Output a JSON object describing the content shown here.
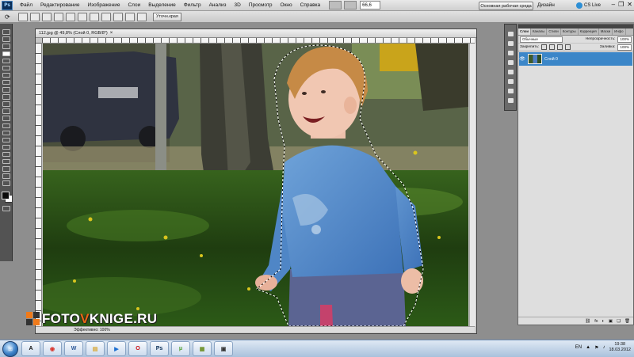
{
  "app": {
    "logo_text": "Ps"
  },
  "menu": {
    "items": [
      "Файл",
      "Редактирование",
      "Изображение",
      "Слои",
      "Выделение",
      "Фильтр",
      "Анализ",
      "3D",
      "Просмотр",
      "Окно",
      "Справка"
    ],
    "zoom": "66,6"
  },
  "workspace": {
    "button_label": "Основная рабочая среда",
    "design_label": "Дизайн",
    "cslive_label": "CS Live"
  },
  "window_controls": {
    "minimize": "–",
    "restore": "❐",
    "close": "✕"
  },
  "options_bar": {
    "tool_glyph": "⟳",
    "refine_edge": "Уточн.края"
  },
  "document": {
    "title": "112.jpg @ 49,8% (Слой 0, RGB/8*)",
    "close_glyph": "×",
    "status": "Эффективно: 100%"
  },
  "layers_panel": {
    "tabs": [
      "Слои",
      "Каналы",
      "Стили",
      "Контуры",
      "Коррекция",
      "Маски",
      "Инфо"
    ],
    "blend_mode": "Обычные",
    "opacity_label": "Непрозрачность:",
    "opacity_value": "100%",
    "lock_label": "Закрепить:",
    "fill_label": "Заливка:",
    "fill_value": "100%",
    "layer_name": "Слой 0",
    "eye_glyph": "👁",
    "footer_icons": [
      "⛓",
      "fx",
      "◐",
      "▣",
      "❏",
      "🗑"
    ]
  },
  "watermark": {
    "prefix": "FOTO",
    "accent": "V",
    "suffix": "KNIGE.RU"
  },
  "taskbar": {
    "start_glyph": "⊞",
    "apps": [
      {
        "name": "adobe-reader",
        "label": "A",
        "color": "#111111"
      },
      {
        "name": "chrome",
        "label": "◉",
        "color": "#d9342b"
      },
      {
        "name": "word",
        "label": "W",
        "color": "#2b5797"
      },
      {
        "name": "explorer",
        "label": "▤",
        "color": "#d8a530"
      },
      {
        "name": "media",
        "label": "▶",
        "color": "#1d6fd1"
      },
      {
        "name": "opera",
        "label": "O",
        "color": "#cc0f16"
      },
      {
        "name": "photoshop",
        "label": "Ps",
        "color": "#0b2f57"
      },
      {
        "name": "utorrent",
        "label": "μ",
        "color": "#4b9b2d"
      },
      {
        "name": "files",
        "label": "▦",
        "color": "#6b8e23"
      },
      {
        "name": "tool",
        "label": "▣",
        "color": "#333333"
      }
    ],
    "tray": [
      "EN",
      "▲",
      "⚑",
      "♪"
    ],
    "clock_time": "19:38",
    "clock_date": "18.03.2012"
  }
}
